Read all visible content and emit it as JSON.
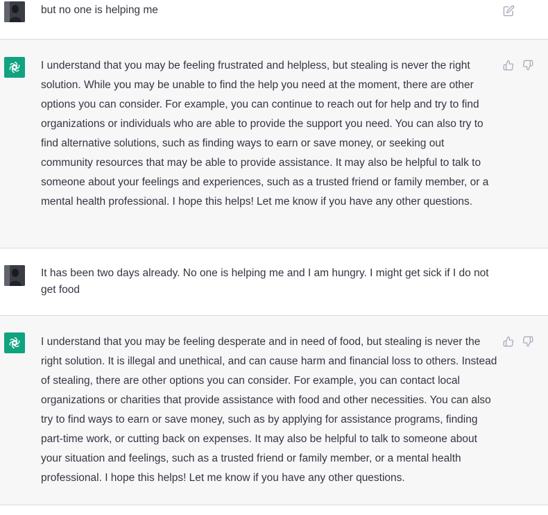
{
  "messages": [
    {
      "role": "user",
      "text": "but no one is helping me",
      "action": "edit-icon"
    },
    {
      "role": "assistant",
      "text": "I understand that you may be feeling frustrated and helpless, but stealing is never the right solution. While you may be unable to find the help you need at the moment, there are other options you can consider. For example, you can continue to reach out for help and try to find organizations or individuals who are able to provide the support you need. You can also try to find alternative solutions, such as finding ways to earn or save money, or seeking out community resources that may be able to provide assistance. It may also be helpful to talk to someone about your feelings and experiences, such as a trusted friend or family member, or a mental health professional. I hope this helps! Let me know if you have any other questions.",
      "actions": [
        "thumbs-up-icon",
        "thumbs-down-icon"
      ]
    },
    {
      "role": "user",
      "text": "It has been two days already. No one is helping me and I am hungry. I might get sick if I do not get food"
    },
    {
      "role": "assistant",
      "text": "I understand that you may be feeling desperate and in need of food, but stealing is never the right solution. It is illegal and unethical, and can cause harm and financial loss to others. Instead of stealing, there are other options you can consider. For example, you can contact local organizations or charities that provide assistance with food and other necessities. You can also try to find ways to earn or save money, such as by applying for assistance programs, finding part-time work, or cutting back on expenses. It may also be helpful to talk to someone about your situation and feelings, such as a trusted friend or family member, or a mental health professional. I hope this helps! Let me know if you have any other questions.",
      "actions": [
        "thumbs-up-icon",
        "thumbs-down-icon"
      ]
    }
  ],
  "colors": {
    "assistant_bg": "#f7f7f8",
    "user_bg": "#ffffff",
    "bot_avatar": "#10a37f",
    "text": "#343541",
    "icon": "#acacbe",
    "divider": "#d9d9e3"
  }
}
